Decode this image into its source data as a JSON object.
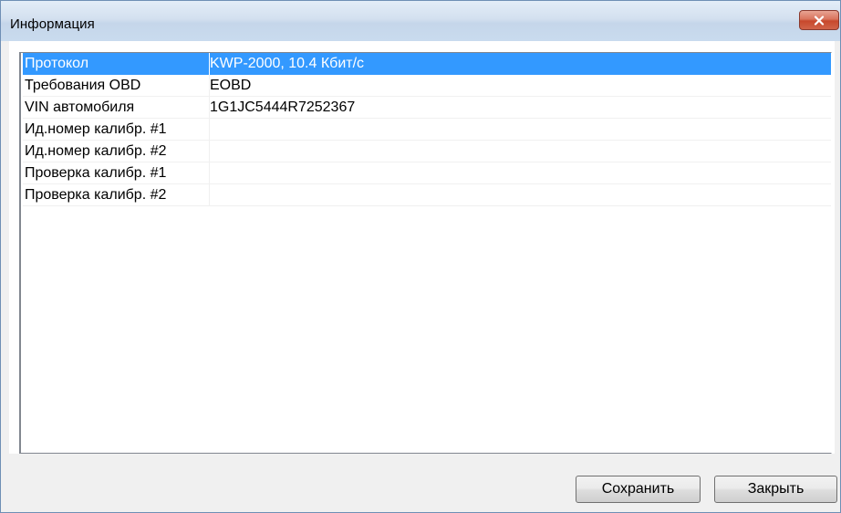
{
  "window": {
    "title": "Информация"
  },
  "info_table": {
    "rows": [
      {
        "name": "Протокол",
        "value": "KWP-2000, 10.4 Кбит/с",
        "selected": true
      },
      {
        "name": "Требования OBD",
        "value": "EOBD",
        "selected": false
      },
      {
        "name": "VIN автомобиля",
        "value": "1G1JC5444R7252367",
        "selected": false
      },
      {
        "name": "Ид.номер калибр. #1",
        "value": "",
        "selected": false
      },
      {
        "name": "Ид.номер калибр. #2",
        "value": "",
        "selected": false
      },
      {
        "name": "Проверка калибр. #1",
        "value": "",
        "selected": false
      },
      {
        "name": "Проверка калибр. #2",
        "value": "",
        "selected": false
      }
    ]
  },
  "buttons": {
    "save_label": "Сохранить",
    "close_label": "Закрыть"
  },
  "icons": {
    "window_close": "close-icon"
  },
  "colors": {
    "selection": "#3399ff",
    "close_button": "#c7482c",
    "titlebar": "#d3e0ef"
  }
}
